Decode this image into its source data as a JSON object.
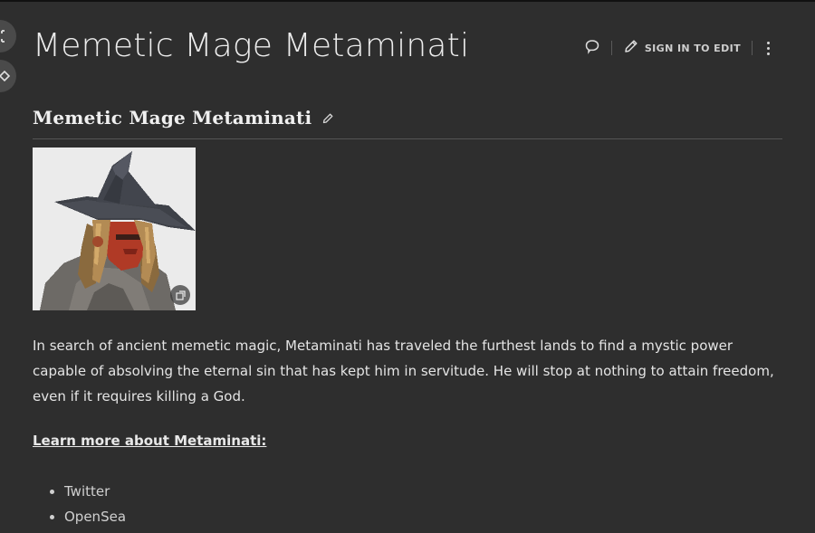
{
  "page": {
    "title": "Memetic Mage Metaminati"
  },
  "actions": {
    "edit_label": "SIGN IN TO EDIT"
  },
  "section": {
    "heading": "Memetic Mage Metaminati"
  },
  "content": {
    "description": "In search of ancient memetic magic, Metaminati has traveled the furthest lands to find a mystic power capable of absolving the eternal sin that has kept him in servitude. He will stop at nothing to attain freedom, even if it requires killing a God.",
    "learn_more": "Learn more about Metaminati:",
    "links": [
      {
        "label": "Twitter"
      },
      {
        "label": "OpenSea"
      }
    ]
  },
  "icons": {
    "side_top": "expand-icon",
    "side_bottom": "tag-icon",
    "comment": "comment-icon",
    "edit": "pencil-icon",
    "more": "kebab-menu-icon",
    "section_edit": "pencil-icon",
    "image_expand": "image-expand-icon"
  },
  "colors": {
    "background": "#2e2e2e",
    "text": "#e6e6e6",
    "divider": "#555555"
  }
}
